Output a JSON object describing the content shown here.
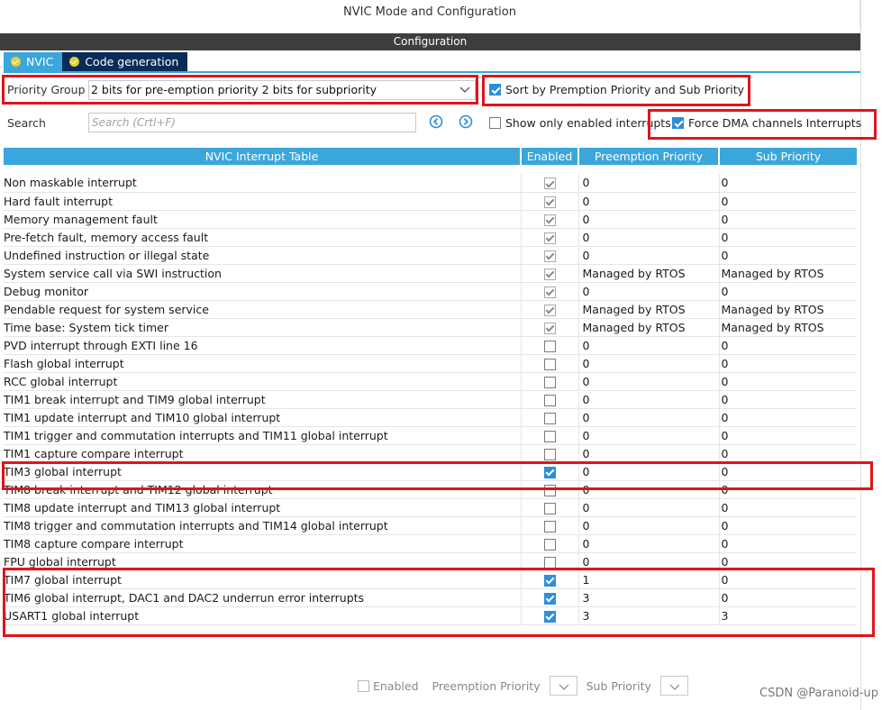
{
  "window_title": "NVIC Mode and Configuration",
  "config_bar_title": "Configuration",
  "tabs": [
    {
      "label": "NVIC",
      "active": true
    },
    {
      "label": "Code generation",
      "active": false
    }
  ],
  "priority_group": {
    "label": "Priority Group",
    "value": "2 bits for pre-emption priority 2 bits for subpriority"
  },
  "options": {
    "sort_label": "Sort by Premption Priority and Sub Priority",
    "sort_checked": true,
    "show_enabled_label": "Show only enabled interrupts",
    "show_enabled_checked": false,
    "force_dma_label": "Force DMA channels Interrupts",
    "force_dma_checked": true
  },
  "search": {
    "label": "Search",
    "placeholder": "Search (Crtl+F)"
  },
  "table": {
    "headers": {
      "name": "NVIC Interrupt Table",
      "enabled": "Enabled",
      "preemption": "Preemption Priority",
      "sub": "Sub Priority"
    },
    "rows": [
      {
        "name": "Non maskable interrupt",
        "enabled": true,
        "locked": true,
        "pre": "0",
        "sub": "0",
        "grey": true
      },
      {
        "name": "Hard fault interrupt",
        "enabled": true,
        "locked": true,
        "pre": "0",
        "sub": "0",
        "grey": true
      },
      {
        "name": "Memory management fault",
        "enabled": true,
        "locked": true,
        "pre": "0",
        "sub": "0",
        "grey": false
      },
      {
        "name": "Pre-fetch fault, memory access fault",
        "enabled": true,
        "locked": true,
        "pre": "0",
        "sub": "0",
        "grey": false
      },
      {
        "name": "Undefined instruction or illegal state",
        "enabled": true,
        "locked": true,
        "pre": "0",
        "sub": "0",
        "grey": false
      },
      {
        "name": "System service call via SWI instruction",
        "enabled": true,
        "locked": true,
        "pre": "Managed by RTOS",
        "sub": "Managed by RTOS",
        "grey": true
      },
      {
        "name": "Debug monitor",
        "enabled": true,
        "locked": true,
        "pre": "0",
        "sub": "0",
        "grey": false
      },
      {
        "name": "Pendable request for system service",
        "enabled": true,
        "locked": true,
        "pre": "Managed by RTOS",
        "sub": "Managed by RTOS",
        "grey": true
      },
      {
        "name": "Time base: System tick timer",
        "enabled": true,
        "locked": true,
        "pre": "Managed by RTOS",
        "sub": "Managed by RTOS",
        "grey": true
      },
      {
        "name": "PVD interrupt through EXTI line 16",
        "enabled": false,
        "locked": false,
        "pre": "0",
        "sub": "0",
        "grey": false
      },
      {
        "name": "Flash global interrupt",
        "enabled": false,
        "locked": false,
        "pre": "0",
        "sub": "0",
        "grey": false
      },
      {
        "name": "RCC global interrupt",
        "enabled": false,
        "locked": false,
        "pre": "0",
        "sub": "0",
        "grey": false
      },
      {
        "name": "TIM1 break interrupt and TIM9 global interrupt",
        "enabled": false,
        "locked": false,
        "pre": "0",
        "sub": "0",
        "grey": false
      },
      {
        "name": "TIM1 update interrupt and TIM10 global interrupt",
        "enabled": false,
        "locked": false,
        "pre": "0",
        "sub": "0",
        "grey": false
      },
      {
        "name": "TIM1 trigger and commutation interrupts and TIM11 global interrupt",
        "enabled": false,
        "locked": false,
        "pre": "0",
        "sub": "0",
        "grey": false
      },
      {
        "name": "TIM1 capture compare interrupt",
        "enabled": false,
        "locked": false,
        "pre": "0",
        "sub": "0",
        "grey": false
      },
      {
        "name": "TIM3 global interrupt",
        "enabled": true,
        "locked": false,
        "pre": "0",
        "sub": "0",
        "grey": false
      },
      {
        "name": "TIM8 break interrupt and TIM12 global interrupt",
        "enabled": false,
        "locked": false,
        "pre": "0",
        "sub": "0",
        "grey": false
      },
      {
        "name": "TIM8 update interrupt and TIM13 global interrupt",
        "enabled": false,
        "locked": false,
        "pre": "0",
        "sub": "0",
        "grey": false
      },
      {
        "name": "TIM8 trigger and commutation interrupts and TIM14 global interrupt",
        "enabled": false,
        "locked": false,
        "pre": "0",
        "sub": "0",
        "grey": false
      },
      {
        "name": "TIM8 capture compare interrupt",
        "enabled": false,
        "locked": false,
        "pre": "0",
        "sub": "0",
        "grey": false
      },
      {
        "name": "FPU global interrupt",
        "enabled": false,
        "locked": false,
        "pre": "0",
        "sub": "0",
        "grey": false
      },
      {
        "name": "TIM7 global interrupt",
        "enabled": true,
        "locked": false,
        "pre": "1",
        "sub": "0",
        "grey": false
      },
      {
        "name": "TIM6 global interrupt, DAC1 and DAC2 underrun error interrupts",
        "enabled": true,
        "locked": false,
        "pre": "3",
        "sub": "0",
        "grey": false
      },
      {
        "name": "USART1 global interrupt",
        "enabled": true,
        "locked": false,
        "pre": "3",
        "sub": "3",
        "grey": false
      }
    ]
  },
  "bottom": {
    "enabled_label": "Enabled",
    "preemption_label": "Preemption Priority",
    "sub_label": "Sub Priority"
  },
  "watermark": "CSDN @Paranoid-up",
  "colors": {
    "accent": "#3aa6dc",
    "tab_inactive": "#082c57",
    "config_bar": "#3e3e3e",
    "highlight_red": "#e0141d",
    "checkbox_blue": "#2f8ed8"
  }
}
